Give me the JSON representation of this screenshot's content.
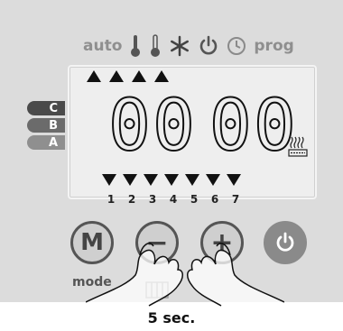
{
  "header": {
    "auto_label": "auto",
    "prog_label": "prog"
  },
  "display": {
    "digits_left": "00",
    "digits_right": "00",
    "days": [
      "1",
      "2",
      "3",
      "4",
      "5",
      "6",
      "7"
    ]
  },
  "modes": [
    {
      "label": "C",
      "color": "#4a4a4a"
    },
    {
      "label": "B",
      "color": "#6b6b6b"
    },
    {
      "label": "A",
      "color": "#8f8f8f"
    }
  ],
  "controls": {
    "mode_button": "M",
    "minus_button": "−",
    "plus_button": "+",
    "mode_label": "mode"
  },
  "caption": "5 sec.",
  "icons": [
    "thermometer-high-icon",
    "thermometer-low-icon",
    "snowflake-icon",
    "power-icon",
    "clock-icon",
    "heater-icon",
    "hand-icon"
  ]
}
